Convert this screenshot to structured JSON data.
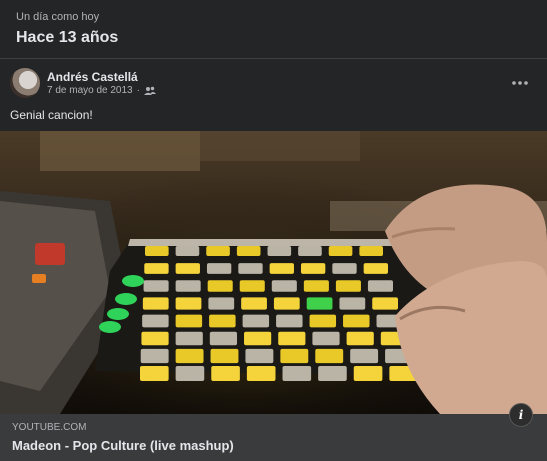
{
  "memory": {
    "kicker": "Un día como hoy",
    "title": "Hace 13 años"
  },
  "post": {
    "author": "Andrés Castellá",
    "date": "7 de mayo de 2013",
    "audience_icon": "friends-icon",
    "more_icon": "more-options-icon",
    "text": "Genial cancion!"
  },
  "link": {
    "domain": "YOUTUBE.COM",
    "title": "Madeon - Pop Culture (live mashup)",
    "info_icon": "i"
  }
}
